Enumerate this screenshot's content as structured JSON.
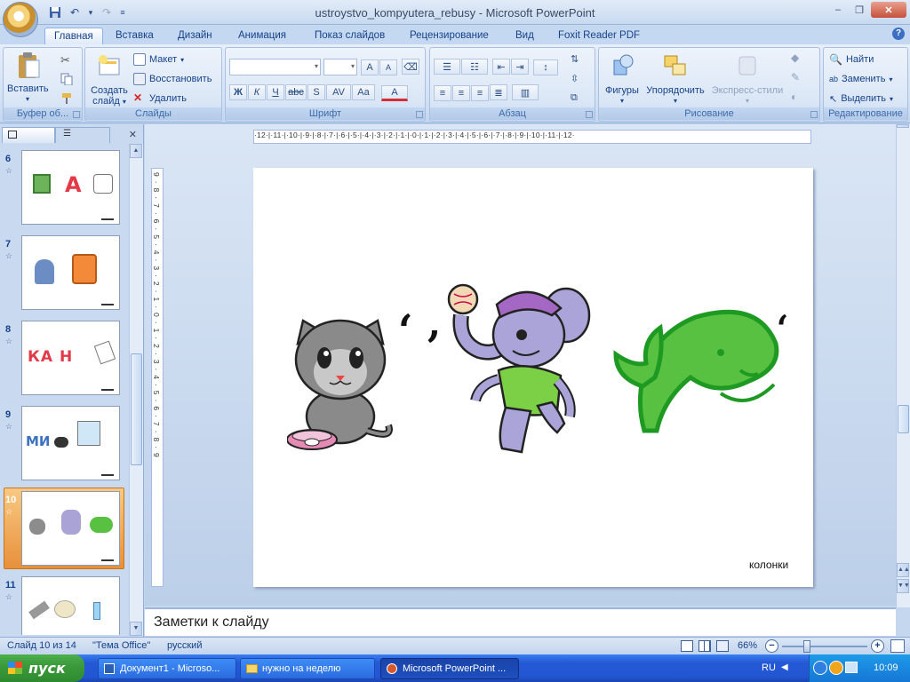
{
  "window": {
    "title": "ustroystvo_kompyutera_rebusy - Microsoft PowerPoint",
    "min": "–",
    "restore": "❐",
    "close": "✕"
  },
  "qat": {
    "save_icon": "save-icon",
    "undo_icon": "undo-icon",
    "redo_icon": "redo-icon",
    "dropdown": "▾"
  },
  "tabs": [
    "Главная",
    "Вставка",
    "Дизайн",
    "Анимация",
    "Показ слайдов",
    "Рецензирование",
    "Вид",
    "Foxit Reader PDF"
  ],
  "help": "?",
  "ribbon": {
    "clipboard": {
      "label": "Буфер об...",
      "paste": "Вставить"
    },
    "slides": {
      "label": "Слайды",
      "new_slide_line1": "Создать",
      "new_slide_line2": "слайд",
      "layout": "Макет",
      "reset": "Восстановить",
      "delete": "Удалить"
    },
    "font": {
      "label": "Шрифт",
      "bold": "Ж",
      "italic": "К",
      "underline": "Ч",
      "strike": "abc",
      "shadow": "S",
      "spacing": "AV",
      "case": "Aa",
      "color": "A",
      "grow": "A",
      "shrink": "A"
    },
    "paragraph": {
      "label": "Абзац"
    },
    "drawing": {
      "label": "Рисование",
      "shapes": "Фигуры",
      "arrange": "Упорядочить",
      "quick_styles": "Экспресс-стили"
    },
    "editing": {
      "label": "Редактирование",
      "find": "Найти",
      "replace": "Заменить",
      "select": "Выделить"
    }
  },
  "ruler": {
    "h_text": "·12·|·11·|·10·|·9·|·8·|·7·|·6·|·5·|·4·|·3·|·2·|·1·|·0·|·1·|·2·|·3·|·4·|·5·|·6·|·7·|·8·|·9·|·10·|·11·|·12·",
    "v_text": "9·8·7·6·5·4·3·2·1·0·1·2·3·4·5·6·7·8·9"
  },
  "thumbnails": [
    {
      "num": "6",
      "star": "☆",
      "content": "A"
    },
    {
      "num": "7",
      "star": "☆",
      "content": ""
    },
    {
      "num": "8",
      "star": "☆",
      "content": "КА Н"
    },
    {
      "num": "9",
      "star": "☆",
      "content": "МИ"
    },
    {
      "num": "10",
      "star": "☆",
      "content": ""
    },
    {
      "num": "11",
      "star": "☆",
      "content": ""
    }
  ],
  "slide": {
    "caption": "колонки",
    "comma1": ",",
    "comma2": ",",
    "comma3": ","
  },
  "notes": {
    "placeholder": "Заметки к слайду"
  },
  "status": {
    "slide": "Слайд 10 из 14",
    "theme": "\"Тема Office\"",
    "lang": "русский",
    "zoom": "66%"
  },
  "taskbar": {
    "start": "пуск",
    "tasks": [
      "Документ1 - Microso...",
      "нужно на неделю",
      "Microsoft PowerPoint ..."
    ],
    "lang": "RU",
    "time": "10:09"
  },
  "colors": {
    "accent": "#15428b",
    "ribbon_bg": "#dae6f6",
    "selected_thumb": "#e8903a",
    "taskbar": "#2458d5",
    "start": "#3b9a3b"
  }
}
